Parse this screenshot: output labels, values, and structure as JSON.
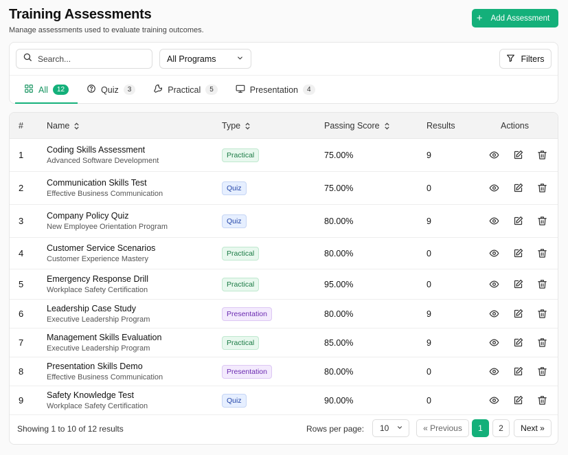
{
  "header": {
    "title": "Training Assessments",
    "subtitle": "Manage assessments used to evaluate training outcomes.",
    "add_button_label": "Add Assessment"
  },
  "filters": {
    "search_placeholder": "Search...",
    "program_select_value": "All Programs",
    "filters_button_label": "Filters"
  },
  "tabs": [
    {
      "label": "All",
      "count": "12",
      "icon": "grid-icon",
      "active": true
    },
    {
      "label": "Quiz",
      "count": "3",
      "icon": "question-circle-icon",
      "active": false
    },
    {
      "label": "Practical",
      "count": "5",
      "icon": "wrench-icon",
      "active": false
    },
    {
      "label": "Presentation",
      "count": "4",
      "icon": "monitor-icon",
      "active": false
    }
  ],
  "table": {
    "columns": {
      "num": "#",
      "name": "Name",
      "type": "Type",
      "passing_score": "Passing Score",
      "results": "Results",
      "actions": "Actions"
    },
    "rows": [
      {
        "num": "1",
        "name": "Coding Skills Assessment",
        "program": "Advanced Software Development",
        "type": "Practical",
        "score": "75.00%",
        "results": "9"
      },
      {
        "num": "2",
        "name": "Communication Skills Test",
        "program": "Effective Business Communication",
        "type": "Quiz",
        "score": "75.00%",
        "results": "0"
      },
      {
        "num": "3",
        "name": "Company Policy Quiz",
        "program": "New Employee Orientation Program",
        "type": "Quiz",
        "score": "80.00%",
        "results": "9"
      },
      {
        "num": "4",
        "name": "Customer Service Scenarios",
        "program": "Customer Experience Mastery",
        "type": "Practical",
        "score": "80.00%",
        "results": "0"
      },
      {
        "num": "5",
        "name": "Emergency Response Drill",
        "program": "Workplace Safety Certification",
        "type": "Practical",
        "score": "95.00%",
        "results": "0"
      },
      {
        "num": "6",
        "name": "Leadership Case Study",
        "program": "Executive Leadership Program",
        "type": "Presentation",
        "score": "80.00%",
        "results": "9"
      },
      {
        "num": "7",
        "name": "Management Skills Evaluation",
        "program": "Executive Leadership Program",
        "type": "Practical",
        "score": "85.00%",
        "results": "9"
      },
      {
        "num": "8",
        "name": "Presentation Skills Demo",
        "program": "Effective Business Communication",
        "type": "Presentation",
        "score": "80.00%",
        "results": "0"
      },
      {
        "num": "9",
        "name": "Safety Knowledge Test",
        "program": "Workplace Safety Certification",
        "type": "Quiz",
        "score": "90.00%",
        "results": "0"
      }
    ]
  },
  "pagination": {
    "showing_text": "Showing 1 to 10 of 12 results",
    "rows_per_page_label": "Rows per page:",
    "rows_per_page_value": "10",
    "previous_label": "« Previous",
    "pages": [
      "1",
      "2"
    ],
    "next_label": "Next »"
  },
  "colors": {
    "accent": "#14b07a"
  }
}
